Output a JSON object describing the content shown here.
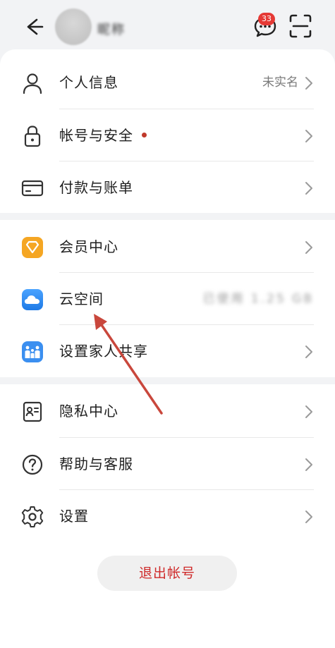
{
  "header": {
    "username": "昵称",
    "message_count": "33"
  },
  "rows": [
    {
      "label": "个人信息",
      "value": "未实名"
    },
    {
      "label": "帐号与安全"
    },
    {
      "label": "付款与账单"
    },
    {
      "label": "会员中心"
    },
    {
      "label": "云空间",
      "value": "已使用 1.25 GB"
    },
    {
      "label": "设置家人共享"
    },
    {
      "label": "隐私中心"
    },
    {
      "label": "帮助与客服"
    },
    {
      "label": "设置"
    }
  ],
  "logout_label": "退出帐号",
  "colors": {
    "accent_red": "#cf2a2a",
    "annotation_arrow": "#c9473c",
    "member_icon": "#f5a623",
    "cloud_icon": "#2f8cf5",
    "family_icon": "#3b8ff0"
  }
}
